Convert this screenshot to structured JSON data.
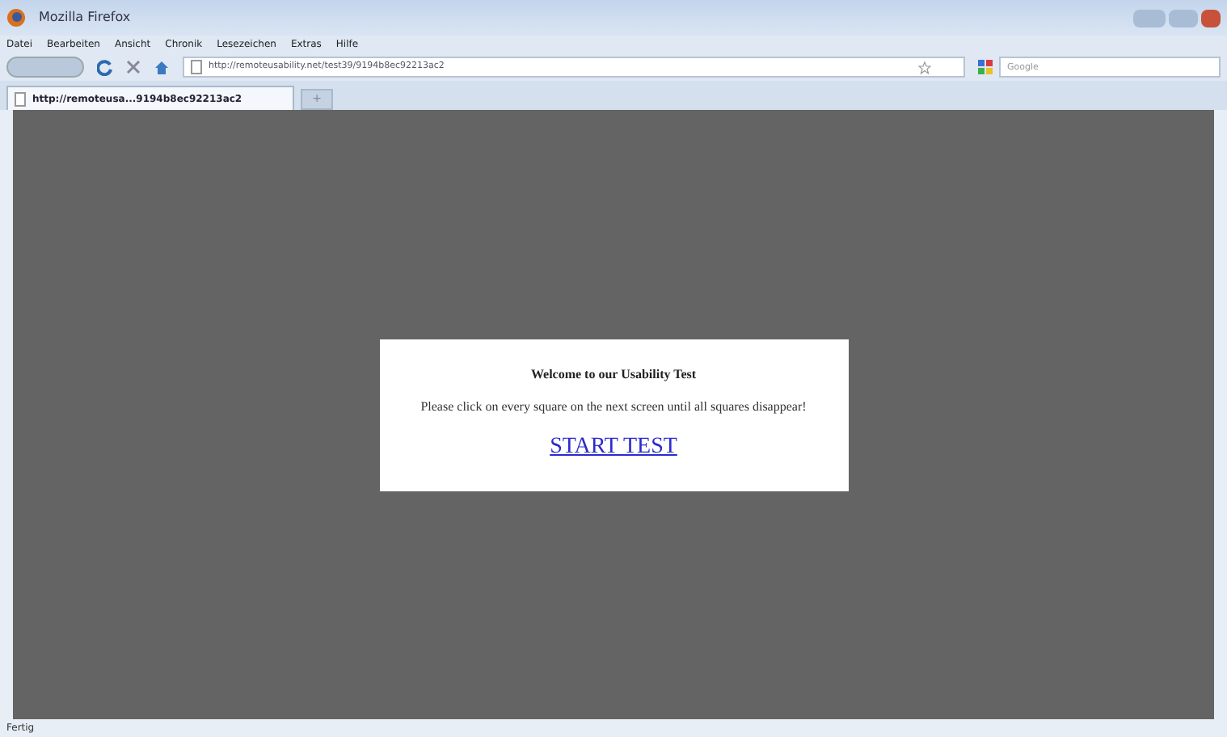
{
  "window": {
    "title": "Mozilla Firefox"
  },
  "menu": [
    "Datei",
    "Bearbeiten",
    "Ansicht",
    "Chronik",
    "Lesezeichen",
    "Extras",
    "Hilfe"
  ],
  "address_bar": {
    "value": "http://remoteusability.net/test39/9194b8ec92213ac2"
  },
  "search": {
    "placeholder": "Google"
  },
  "tabs": [
    {
      "label": "http://remoteusa...9194b8ec92213ac2",
      "selected": true
    }
  ],
  "new_tab": "+",
  "dialog": {
    "heading": "Welcome to our Usability Test",
    "text": "Please click on every square on the next screen until all squares disappear!",
    "link": "START TEST"
  },
  "status_bar": "Fertig"
}
